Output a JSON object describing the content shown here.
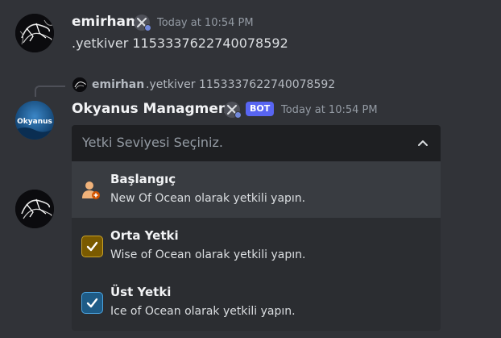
{
  "message1": {
    "author": "emirhan",
    "timestamp": "Today at 10:54 PM",
    "content": ".yetkiver 1153337622740078592"
  },
  "reply": {
    "author": "emirhan",
    "content": ".yetkiver 1153337622740078592"
  },
  "message2": {
    "author": "Okyanus Managment",
    "bot_tag": "BOT",
    "timestamp": "Today at 10:54 PM",
    "avatar_text": "Okyanus"
  },
  "select_menu": {
    "placeholder": "Yetki Seviyesi Seçiniz.",
    "expanded": true,
    "options": [
      {
        "label": "Başlangıç",
        "description": "New Of Ocean olarak yetkili yapın.",
        "icon": "person-add-icon",
        "icon_color": "#f0b27a",
        "highlighted": true
      },
      {
        "label": "Orta Yetki",
        "description": "Wise of Ocean olarak yetkili yapın.",
        "icon": "check-box-icon",
        "icon_color": "#7a5a00",
        "highlighted": false
      },
      {
        "label": "Üst Yetki",
        "description": "Ice of Ocean olarak yetkili yapın.",
        "icon": "check-box-icon",
        "icon_color": "#1e5b86",
        "highlighted": false
      }
    ]
  },
  "colors": {
    "background": "#313338",
    "menu": "#2b2d31",
    "select": "#1e1f22",
    "bot_tag": "#5865f2"
  }
}
